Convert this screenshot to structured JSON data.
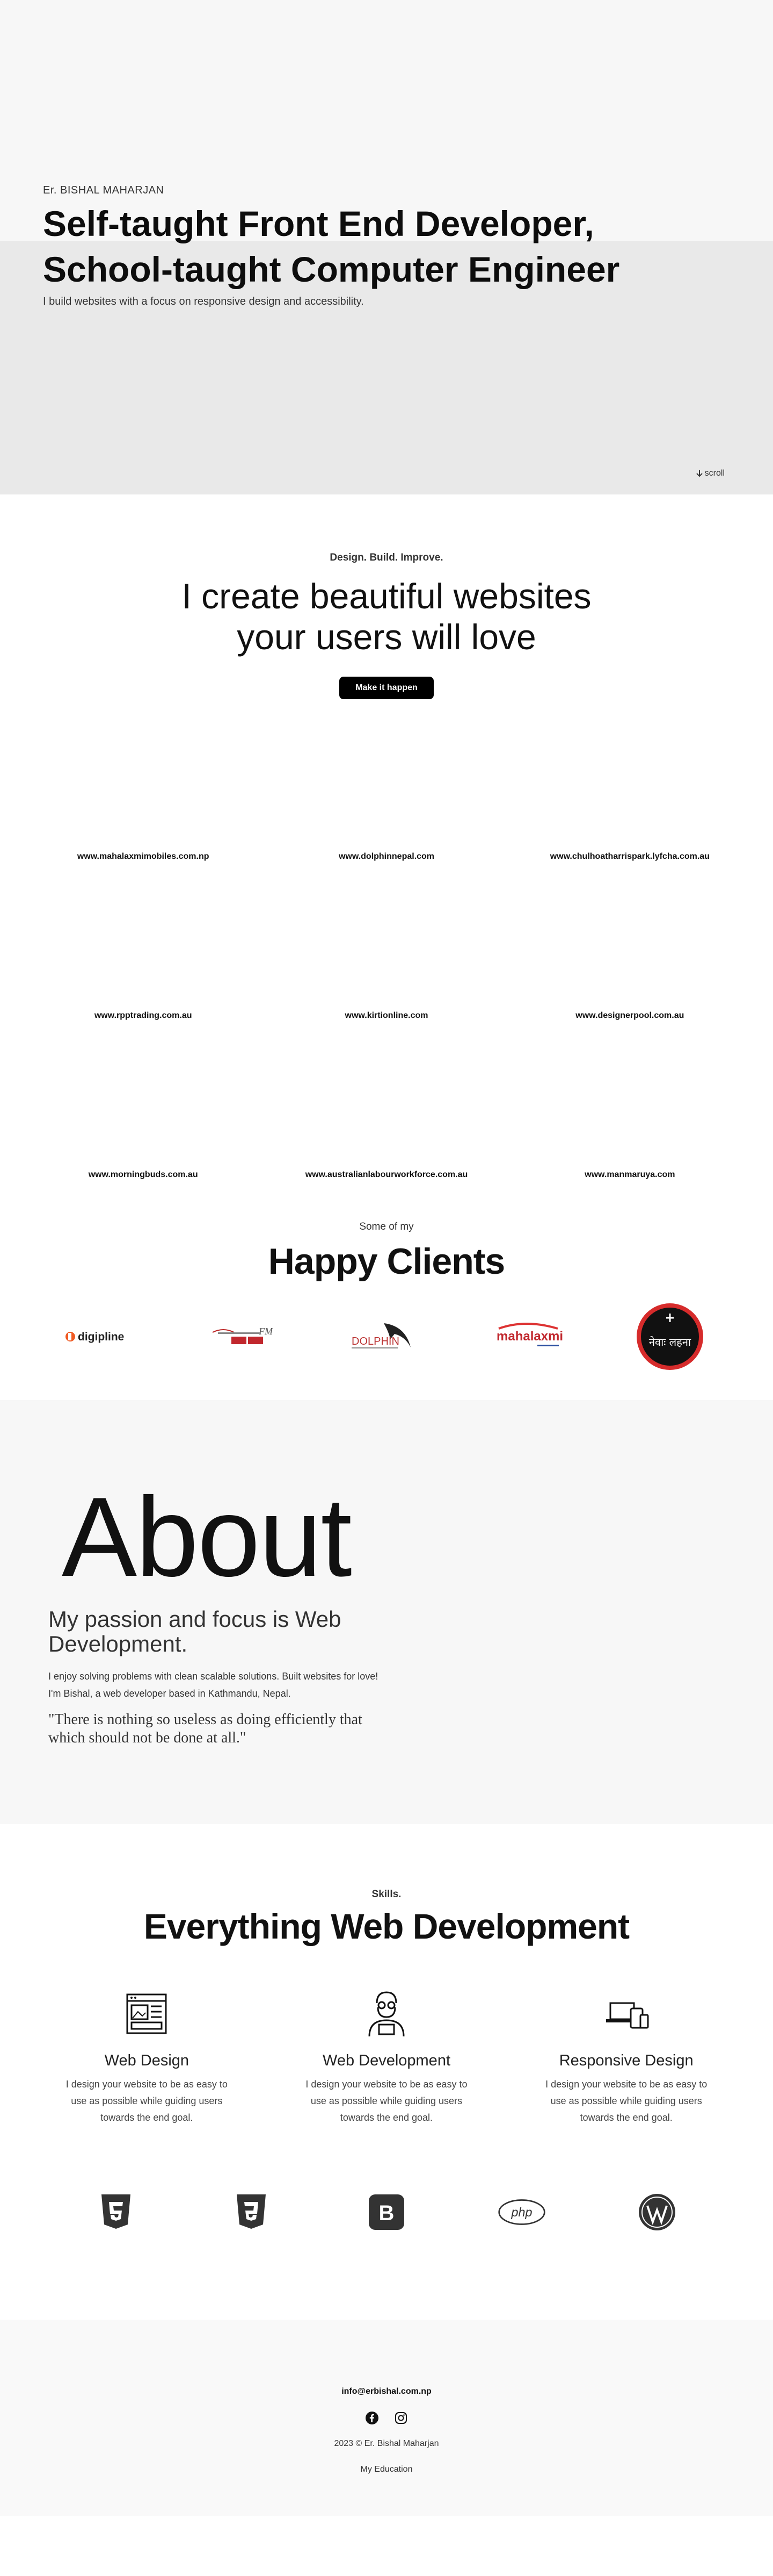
{
  "hero": {
    "eyebrow": "Er. BISHAL MAHARJAN",
    "headline_1": "Self-taught Front End Developer,",
    "headline_2": "School-taught Computer Engineer",
    "lead": "I build websites with a focus on responsive design and accessibility.",
    "scroll": "scroll"
  },
  "cta": {
    "sub": "Design. Build. Improve.",
    "heading_1": "I create beautiful websites",
    "heading_2": "your users will love",
    "button": "Make it happen"
  },
  "portfolio": [
    "www.mahalaxmimobiles.com.np",
    "www.dolphinnepal.com",
    "www.chulhoatharrispark.lyfcha.com.au",
    "www.rpptrading.com.au",
    "www.kirtionline.com",
    "www.designerpool.com.au",
    "www.morningbuds.com.au",
    "www.australianlabourworkforce.com.au",
    "www.manmaruya.com"
  ],
  "clients": {
    "sub": "Some of my",
    "heading": "Happy Clients",
    "logos": [
      {
        "name": "digipline",
        "text": "digipline"
      },
      {
        "name": "fm",
        "text": "FM"
      },
      {
        "name": "dolphin",
        "text": "DOLPHIN"
      },
      {
        "name": "mahalaxmi",
        "text": "mahalaxmi"
      },
      {
        "name": "newa",
        "text": "नेवाः लहना"
      }
    ]
  },
  "about": {
    "heading": "About",
    "subheading": "My passion and focus is Web Development.",
    "body": "I enjoy solving problems with clean scalable solutions. Built websites for love! I'm Bishal, a web developer based in Kathmandu, Nepal.",
    "quote": "\"There is nothing so useless as doing efficiently that which should not be done at all.\""
  },
  "skills": {
    "sub": "Skills.",
    "heading": "Everything Web Development",
    "cards": [
      {
        "title": "Web Design",
        "text": "I design your website to be as easy to use as possible while guiding users towards the end goal."
      },
      {
        "title": "Web Development",
        "text": "I design your website to be as easy to use as possible while guiding users towards the end goal."
      },
      {
        "title": "Responsive Design",
        "text": "I design your website to be as easy to use as possible while guiding users towards the end goal."
      }
    ],
    "tech": [
      "html5",
      "css3",
      "bootstrap",
      "php",
      "wordpress"
    ],
    "php_label": "php"
  },
  "footer": {
    "email": "info@erbishal.com.np",
    "copyright": "2023 © Er. Bishal Maharjan",
    "education": "My Education"
  }
}
